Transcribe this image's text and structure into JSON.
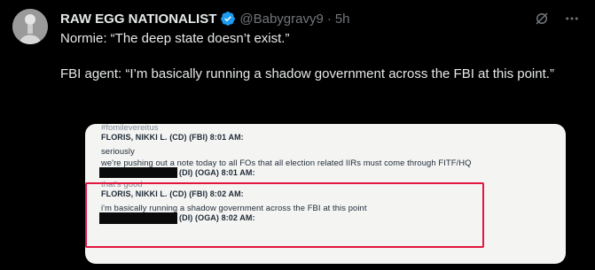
{
  "tweet": {
    "display_name": "RAW EGG NATIONALIST",
    "handle": "@Babygravy9",
    "separator": "·",
    "time": "5h",
    "text": "Normie: “The deep state doesn’t exist.”\n\nFBI agent: “I’m basically running a shadow government across the FBI at this point.”"
  },
  "colors": {
    "verified": "#1d9bf0",
    "highlight_border": "#e2163f"
  },
  "media": {
    "lines": {
      "top_cut": "#fomilevereitus",
      "header1": "FLORIS, NIKKI L. (CD) (FBI) 8:01 AM:",
      "msg1": "seriously",
      "msg2": "we're pushing out a note today to all FOs that all election related IIRs must come through FITF/HQ",
      "header2": "(DI) (OGA) 8:01 AM:",
      "msg3": "that's good",
      "header3": "FLORIS, NIKKI L. (CD) (FBI) 8:02 AM:",
      "msg4": "i'm basically running a shadow government across the FBI at this point",
      "header4": "(DI) (OGA) 8:02 AM:"
    }
  }
}
